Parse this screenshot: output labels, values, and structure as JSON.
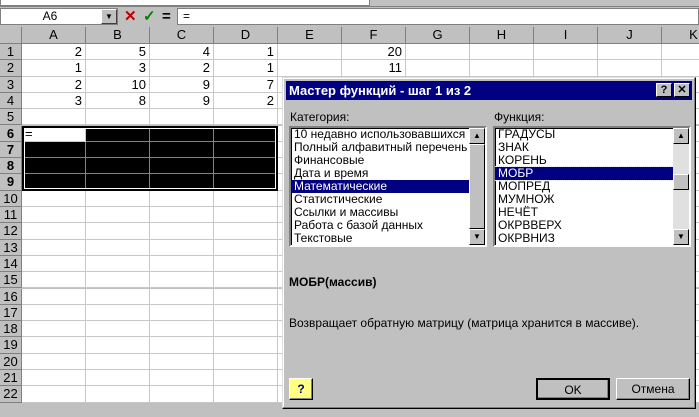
{
  "formula_bar": {
    "name_box": "A6",
    "cancel_icon": "x-icon",
    "enter_icon": "check-icon",
    "equals_label": "=",
    "formula": "="
  },
  "columns": [
    "A",
    "B",
    "C",
    "D",
    "E",
    "F",
    "G",
    "H",
    "I",
    "J",
    "K"
  ],
  "rows": [
    "1",
    "2",
    "3",
    "4",
    "5",
    "6",
    "7",
    "8",
    "9",
    "10",
    "11",
    "12",
    "13",
    "14",
    "15",
    "16",
    "17",
    "18",
    "19",
    "20",
    "21",
    "22"
  ],
  "cells": {
    "A1": "2",
    "B1": "5",
    "C1": "4",
    "D1": "1",
    "F1": "20",
    "A2": "1",
    "B2": "3",
    "C2": "2",
    "D2": "1",
    "F2": "11",
    "A3": "2",
    "B3": "10",
    "C3": "9",
    "D3": "7",
    "A4": "3",
    "B4": "8",
    "C4": "9",
    "D4": "2",
    "A6": "="
  },
  "dialog": {
    "title": "Мастер функций - шаг 1 из 2",
    "help_btn": "?",
    "close_btn": "✕",
    "category_label": "Категория:",
    "categories": [
      "10 недавно использовавшихся",
      "Полный алфавитный перечень",
      "Финансовые",
      "Дата и время",
      "Математические",
      "Статистические",
      "Ссылки и массивы",
      "Работа с базой данных",
      "Текстовые"
    ],
    "selected_category_index": 4,
    "function_label": "Функция:",
    "functions": [
      "ГРАДУСЫ",
      "ЗНАК",
      "КОРЕНЬ",
      "МОБР",
      "МОПРЕД",
      "МУМНОЖ",
      "НЕЧЁТ",
      "ОКРВВЕРХ",
      "ОКРВНИЗ"
    ],
    "selected_function_index": 3,
    "signature": "МОБР(массив)",
    "description": "Возвращает обратную матрицу (матрица хранится в массиве).",
    "ok": "OK",
    "cancel": "Отмена",
    "office_help_icon": "?"
  }
}
